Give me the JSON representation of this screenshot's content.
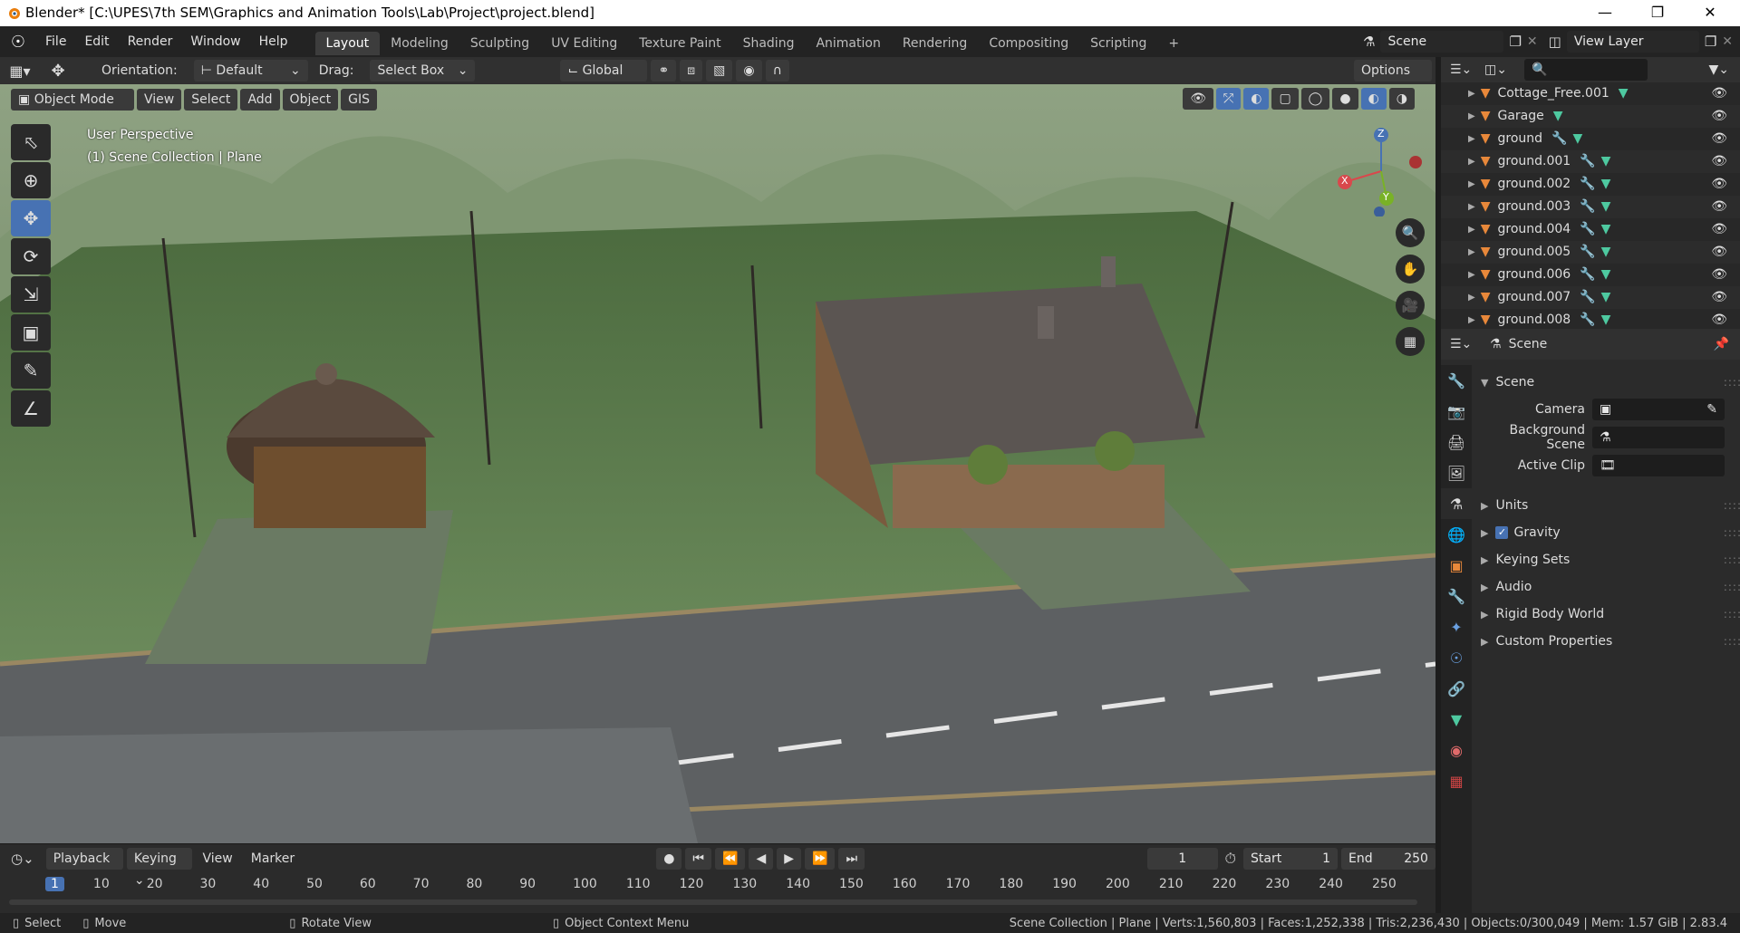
{
  "window": {
    "title": "Blender* [C:\\UPES\\7th SEM\\Graphics and Animation Tools\\Lab\\Project\\project.blend]"
  },
  "menus": [
    "File",
    "Edit",
    "Render",
    "Window",
    "Help"
  ],
  "workspaces": [
    "Layout",
    "Modeling",
    "Sculpting",
    "UV Editing",
    "Texture Paint",
    "Shading",
    "Animation",
    "Rendering",
    "Compositing",
    "Scripting"
  ],
  "topbar": {
    "scene": "Scene",
    "view_layer": "View Layer"
  },
  "viewport_header": {
    "orientation_label": "Orientation:",
    "orientation_value": "Default",
    "drag_label": "Drag:",
    "drag_value": "Select Box",
    "transform_orientation": "Global",
    "options": "Options"
  },
  "viewport_sub": {
    "mode": "Object Mode",
    "view": "View",
    "select": "Select",
    "add": "Add",
    "object": "Object",
    "gis": "GIS"
  },
  "viewport_info": {
    "line1": "User Perspective",
    "line2": "(1) Scene Collection | Plane"
  },
  "gizmo": {
    "x": "X",
    "y": "Y",
    "z": "Z"
  },
  "outliner": {
    "items": [
      {
        "name": "Cottage_Free.001"
      },
      {
        "name": "Garage"
      },
      {
        "name": "ground"
      },
      {
        "name": "ground.001"
      },
      {
        "name": "ground.002"
      },
      {
        "name": "ground.003"
      },
      {
        "name": "ground.004"
      },
      {
        "name": "ground.005"
      },
      {
        "name": "ground.006"
      },
      {
        "name": "ground.007"
      },
      {
        "name": "ground.008"
      }
    ]
  },
  "properties": {
    "header": "Scene",
    "panel": "Scene",
    "camera_label": "Camera",
    "bg_scene_label": "Background Scene",
    "active_clip_label": "Active Clip",
    "sections": [
      "Units",
      "Gravity",
      "Keying Sets",
      "Audio",
      "Rigid Body World",
      "Custom Properties"
    ]
  },
  "timeline": {
    "playback": "Playback",
    "keying": "Keying",
    "view": "View",
    "marker": "Marker",
    "current_frame": "1",
    "start_label": "Start",
    "start_value": "1",
    "end_label": "End",
    "end_value": "250",
    "ruler": [
      "1",
      "10",
      "20",
      "30",
      "40",
      "50",
      "60",
      "70",
      "80",
      "90",
      "100",
      "110",
      "120",
      "130",
      "140",
      "150",
      "160",
      "170",
      "180",
      "190",
      "200",
      "210",
      "220",
      "230",
      "240",
      "250"
    ]
  },
  "statusbar": {
    "select": "Select",
    "move": "Move",
    "rotate": "Rotate View",
    "context": "Object Context Menu",
    "stats": "Scene Collection | Plane | Verts:1,560,803 | Faces:1,252,338 | Tris:2,236,430 | Objects:0/300,049 | Mem: 1.57 GiB | 2.83.4"
  },
  "colors": {
    "accent": "#4772b3",
    "object_orange": "#e8883a",
    "mesh_green": "#4ec9a0"
  }
}
